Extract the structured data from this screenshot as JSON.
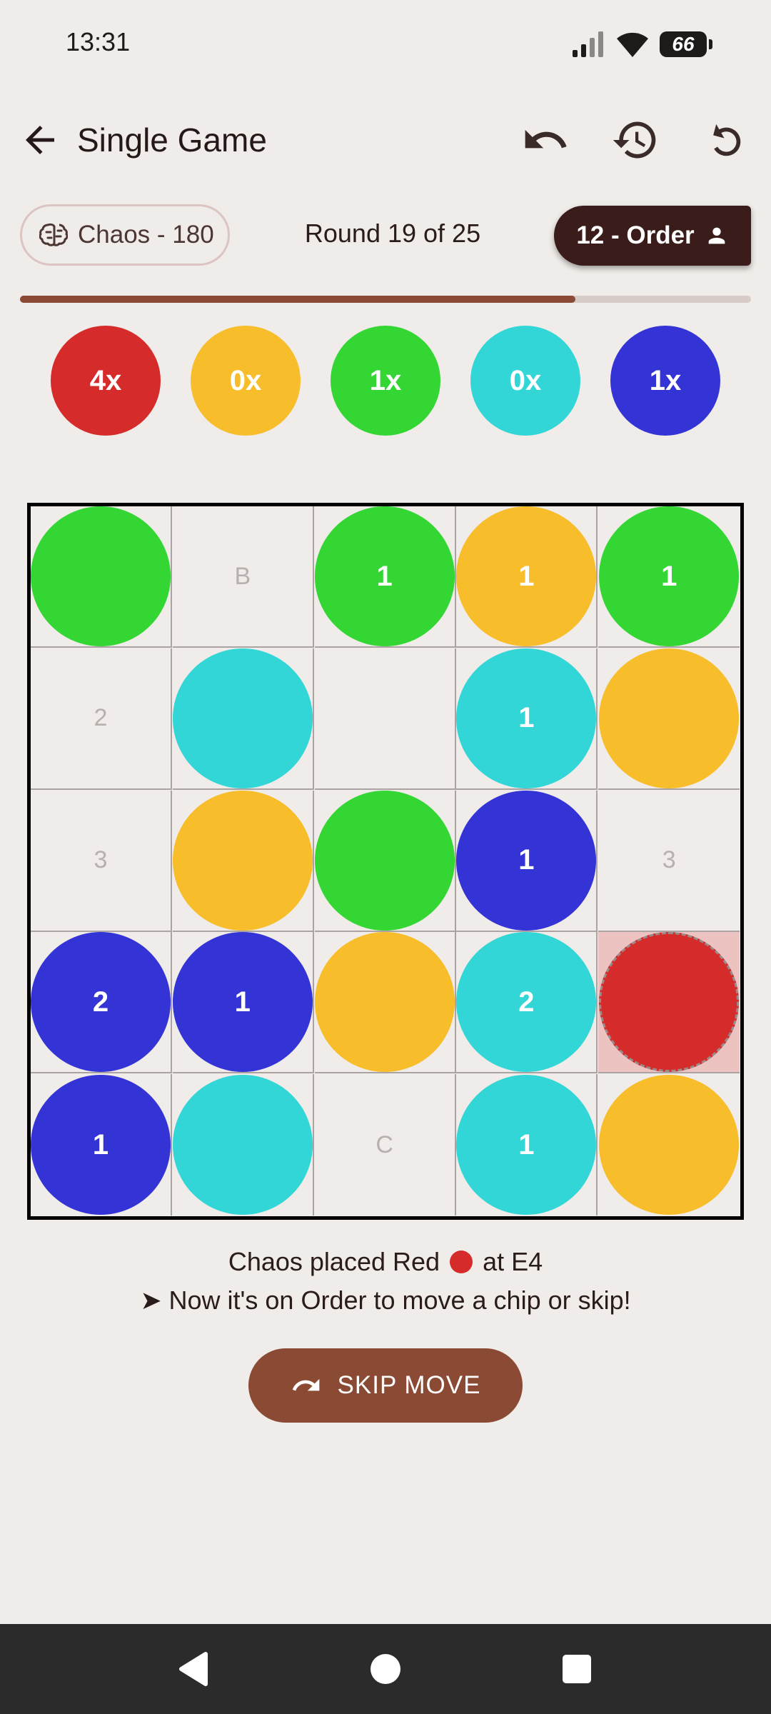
{
  "status_bar": {
    "time": "13:31",
    "battery": "66"
  },
  "app_bar": {
    "title": "Single Game"
  },
  "players": {
    "chaos_label": "Chaos - 180",
    "round_text": "Round 19 of 25",
    "order_label": "12 - Order"
  },
  "progress": {
    "value": 0.76
  },
  "colors": {
    "red": "#d62b2b",
    "yellow": "#f7bd2b",
    "green": "#33d633",
    "cyan": "#33d6d6",
    "blue": "#3333d6",
    "accent": "#8a4a33",
    "order_chip": "#3a1c1b"
  },
  "chip_counts": [
    {
      "color": "red",
      "label": "4x"
    },
    {
      "color": "yellow",
      "label": "0x"
    },
    {
      "color": "green",
      "label": "1x"
    },
    {
      "color": "cyan",
      "label": "0x"
    },
    {
      "color": "blue",
      "label": "1x"
    }
  ],
  "board": [
    [
      {
        "chip": "green",
        "text": ""
      },
      {
        "chip": null,
        "text": "B"
      },
      {
        "chip": "green",
        "text": "1"
      },
      {
        "chip": "yellow",
        "text": "1"
      },
      {
        "chip": "green",
        "text": "1"
      }
    ],
    [
      {
        "chip": null,
        "text": "2"
      },
      {
        "chip": "cyan",
        "text": ""
      },
      {
        "chip": null,
        "text": ""
      },
      {
        "chip": "cyan",
        "text": "1"
      },
      {
        "chip": "yellow",
        "text": ""
      }
    ],
    [
      {
        "chip": null,
        "text": "3"
      },
      {
        "chip": "yellow",
        "text": ""
      },
      {
        "chip": "green",
        "text": ""
      },
      {
        "chip": "blue",
        "text": "1"
      },
      {
        "chip": null,
        "text": "3"
      }
    ],
    [
      {
        "chip": "blue",
        "text": "2"
      },
      {
        "chip": "blue",
        "text": "1"
      },
      {
        "chip": "yellow",
        "text": ""
      },
      {
        "chip": "cyan",
        "text": "2"
      },
      {
        "chip": "red",
        "text": "",
        "last": true
      }
    ],
    [
      {
        "chip": "blue",
        "text": "1"
      },
      {
        "chip": "cyan",
        "text": ""
      },
      {
        "chip": null,
        "text": "C"
      },
      {
        "chip": "cyan",
        "text": "1"
      },
      {
        "chip": "yellow",
        "text": ""
      }
    ]
  ],
  "message": {
    "line1_prefix": "Chaos placed Red",
    "line1_suffix": "at E4",
    "line2": "➤ Now it's on Order to move a chip or skip!"
  },
  "skip_button": {
    "label": "SKIP MOVE"
  }
}
